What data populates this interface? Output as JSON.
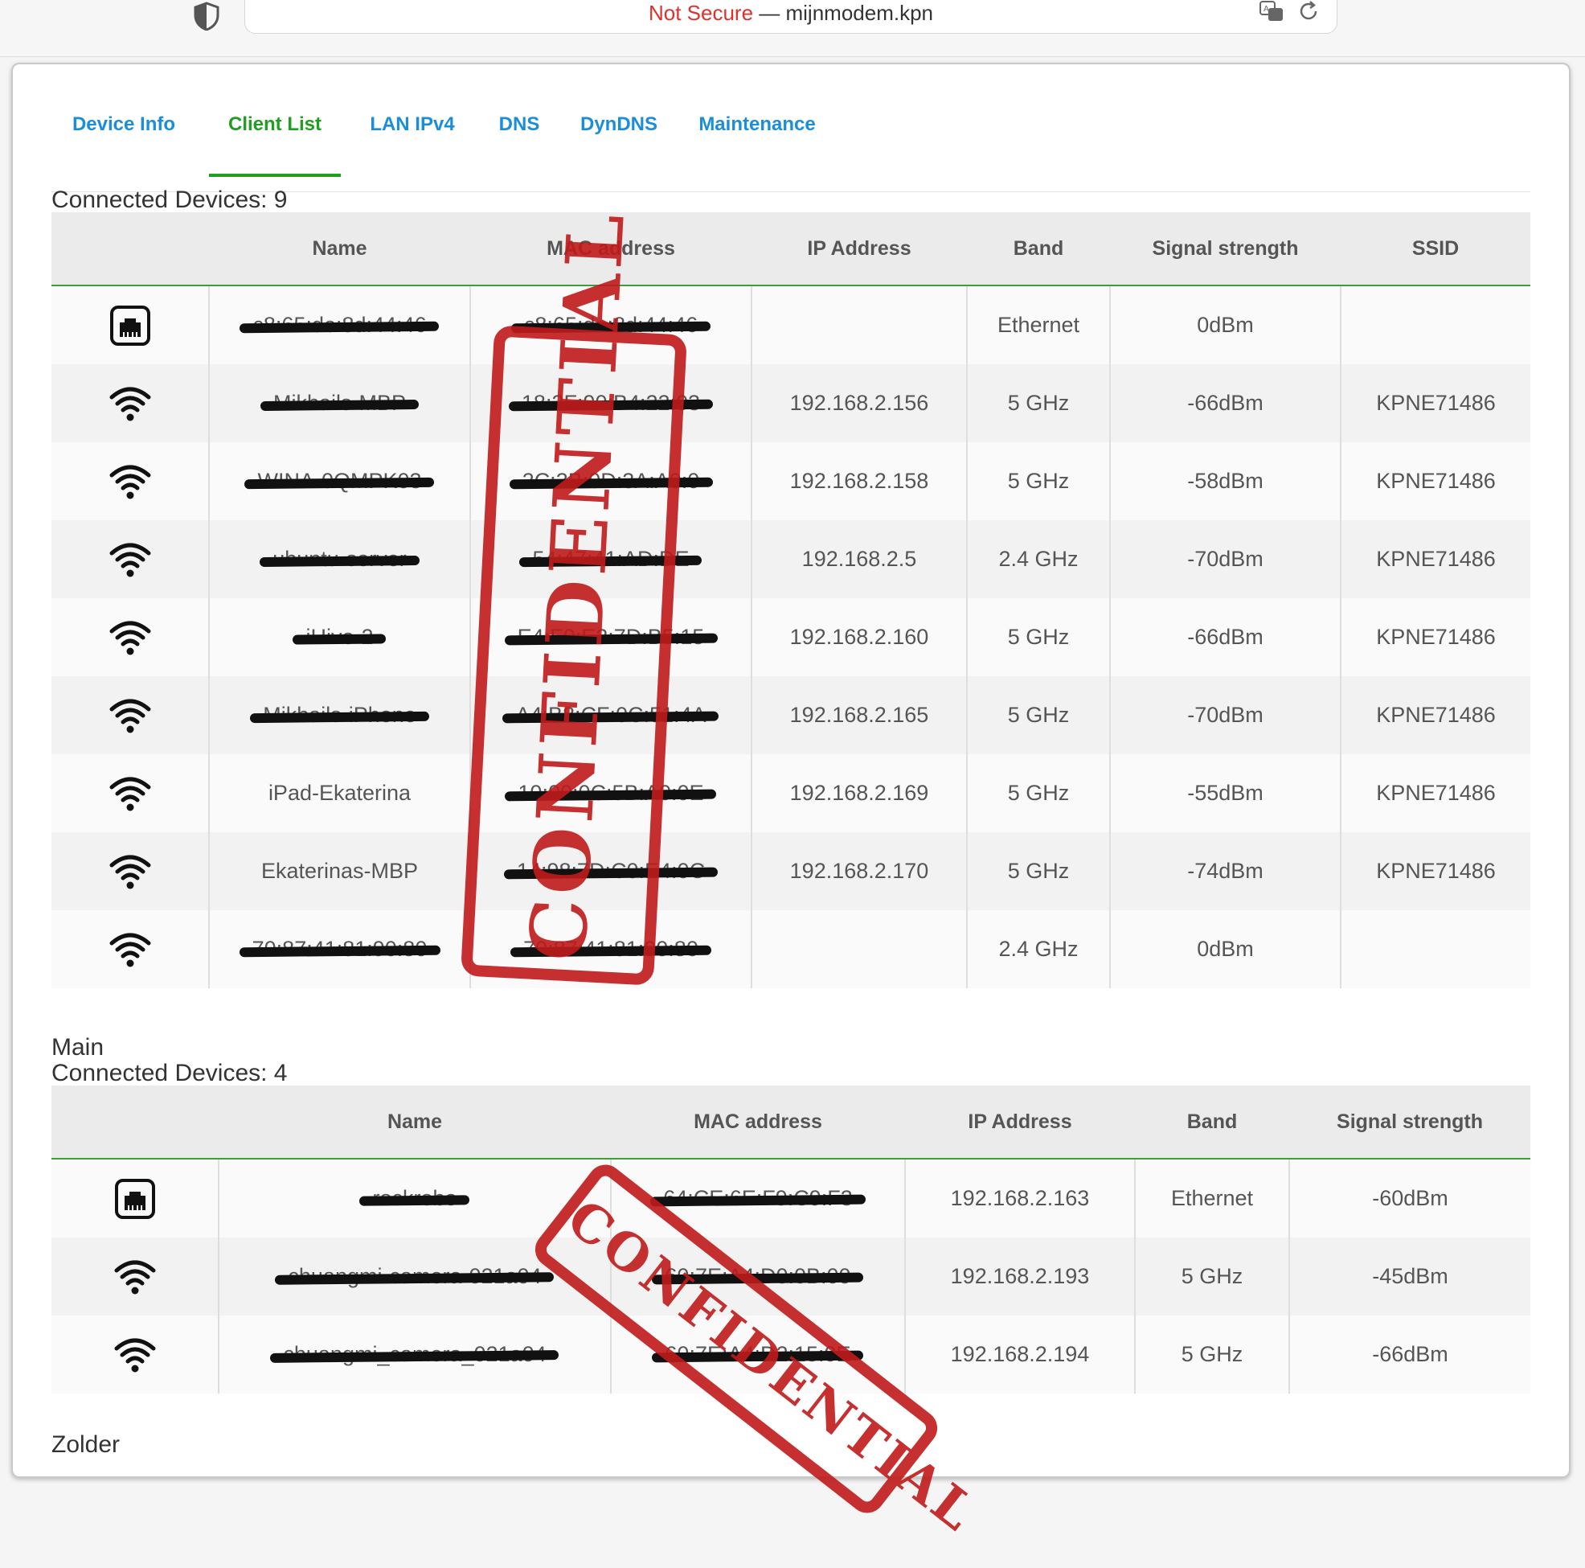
{
  "browser": {
    "not_secure": "Not Secure",
    "separator": " — ",
    "host": "mijnmodem.kpn"
  },
  "tabs": [
    {
      "label": "Device Info",
      "active": false
    },
    {
      "label": "Client List",
      "active": true
    },
    {
      "label": "LAN IPv4",
      "active": false
    },
    {
      "label": "DNS",
      "active": false
    },
    {
      "label": "DynDNS",
      "active": false
    },
    {
      "label": "Maintenance",
      "active": false
    }
  ],
  "section1": {
    "title": "Connected Devices: 9",
    "headers": [
      "",
      "Name",
      "MAC address",
      "IP Address",
      "Band",
      "Signal strength",
      "SSID"
    ],
    "rows": [
      {
        "icon": "ethernet-icon",
        "name": "c8:65:de:8d:44:46",
        "name_redacted": true,
        "mac": "c8:65:de:8d:44:46",
        "mac_redacted": true,
        "ip": "",
        "band": "Ethernet",
        "signal": "0dBm",
        "ssid": ""
      },
      {
        "icon": "wifi-icon",
        "name": "Mikhails-MBP",
        "name_redacted": true,
        "mac": "18:3F:90:B4:22:03",
        "mac_redacted": true,
        "ip": "192.168.2.156",
        "band": "5 GHz",
        "signal": "-66dBm",
        "ssid": "KPNE71486"
      },
      {
        "icon": "wifi-icon",
        "name": "WINA-0QMPK03",
        "name_redacted": true,
        "mac": "2C:3B:0D:3A:A0:0",
        "mac_redacted": true,
        "ip": "192.168.2.158",
        "band": "5 GHz",
        "signal": "-58dBm",
        "ssid": "KPNE71486"
      },
      {
        "icon": "wifi-icon",
        "name": "ubuntu-server",
        "name_redacted": true,
        "mac": "54:47:41:AD:DE",
        "mac_redacted": true,
        "ip": "192.168.2.5",
        "band": "2.4 GHz",
        "signal": "-70dBm",
        "ssid": "KPNE71486"
      },
      {
        "icon": "wifi-icon",
        "name": "iHive-2",
        "name_redacted": true,
        "mac": "E4:F0:E2:7D:B5:15",
        "mac_redacted": true,
        "ip": "192.168.2.160",
        "band": "5 GHz",
        "signal": "-66dBm",
        "ssid": "KPNE71486"
      },
      {
        "icon": "wifi-icon",
        "name": "Mikhails-iPhone",
        "name_redacted": true,
        "mac": "A4:B8:CF:0C:51:4A",
        "mac_redacted": true,
        "ip": "192.168.2.165",
        "band": "5 GHz",
        "signal": "-70dBm",
        "ssid": "KPNE71486"
      },
      {
        "icon": "wifi-icon",
        "name": "iPad-Ekaterina",
        "name_redacted": false,
        "mac": "10:00:0C:5B:A0:0E",
        "mac_redacted": true,
        "ip": "192.168.2.169",
        "band": "5 GHz",
        "signal": "-55dBm",
        "ssid": "KPNE71486"
      },
      {
        "icon": "wifi-icon",
        "name": "Ekaterinas-MBP",
        "name_redacted": false,
        "mac": "14:98:7D:C0:E4:0C",
        "mac_redacted": true,
        "ip": "192.168.2.170",
        "band": "5 GHz",
        "signal": "-74dBm",
        "ssid": "KPNE71486"
      },
      {
        "icon": "wifi-icon",
        "name": "70:87:41:81:90:80",
        "name_redacted": true,
        "mac": "70:87:41:81:90:80",
        "mac_redacted": true,
        "ip": "",
        "band": "2.4 GHz",
        "signal": "0dBm",
        "ssid": ""
      }
    ]
  },
  "section2": {
    "group": "Main",
    "title": "Connected Devices: 4",
    "headers": [
      "",
      "Name",
      "MAC address",
      "IP Address",
      "Band",
      "Signal strength"
    ],
    "rows": [
      {
        "icon": "ethernet-icon",
        "name": "rockrobo",
        "name_redacted": true,
        "mac": "64:CE:6E:F9:C9:F3",
        "mac_redacted": true,
        "ip": "192.168.2.163",
        "band": "Ethernet",
        "signal": "-60dBm"
      },
      {
        "icon": "wifi-icon",
        "name": "chuangmi-camera-021a04",
        "name_redacted": true,
        "mac": "60:7E:A4:D0:0B:00",
        "mac_redacted": true,
        "ip": "192.168.2.193",
        "band": "5 GHz",
        "signal": "-45dBm"
      },
      {
        "icon": "wifi-icon",
        "name": "chuangmi_camera_021a04",
        "name_redacted": true,
        "mac": "60:7E:A4:D2:15:0E",
        "mac_redacted": true,
        "ip": "192.168.2.194",
        "band": "5 GHz",
        "signal": "-66dBm"
      }
    ]
  },
  "section3": {
    "group": "Zolder"
  },
  "stamp_text": "CONFIDENTIAL",
  "colors": {
    "tab_link": "#1a8ddb",
    "tab_active": "#1f9e1f",
    "not_secure": "#e0302c",
    "stamp": "#c01a1a"
  }
}
